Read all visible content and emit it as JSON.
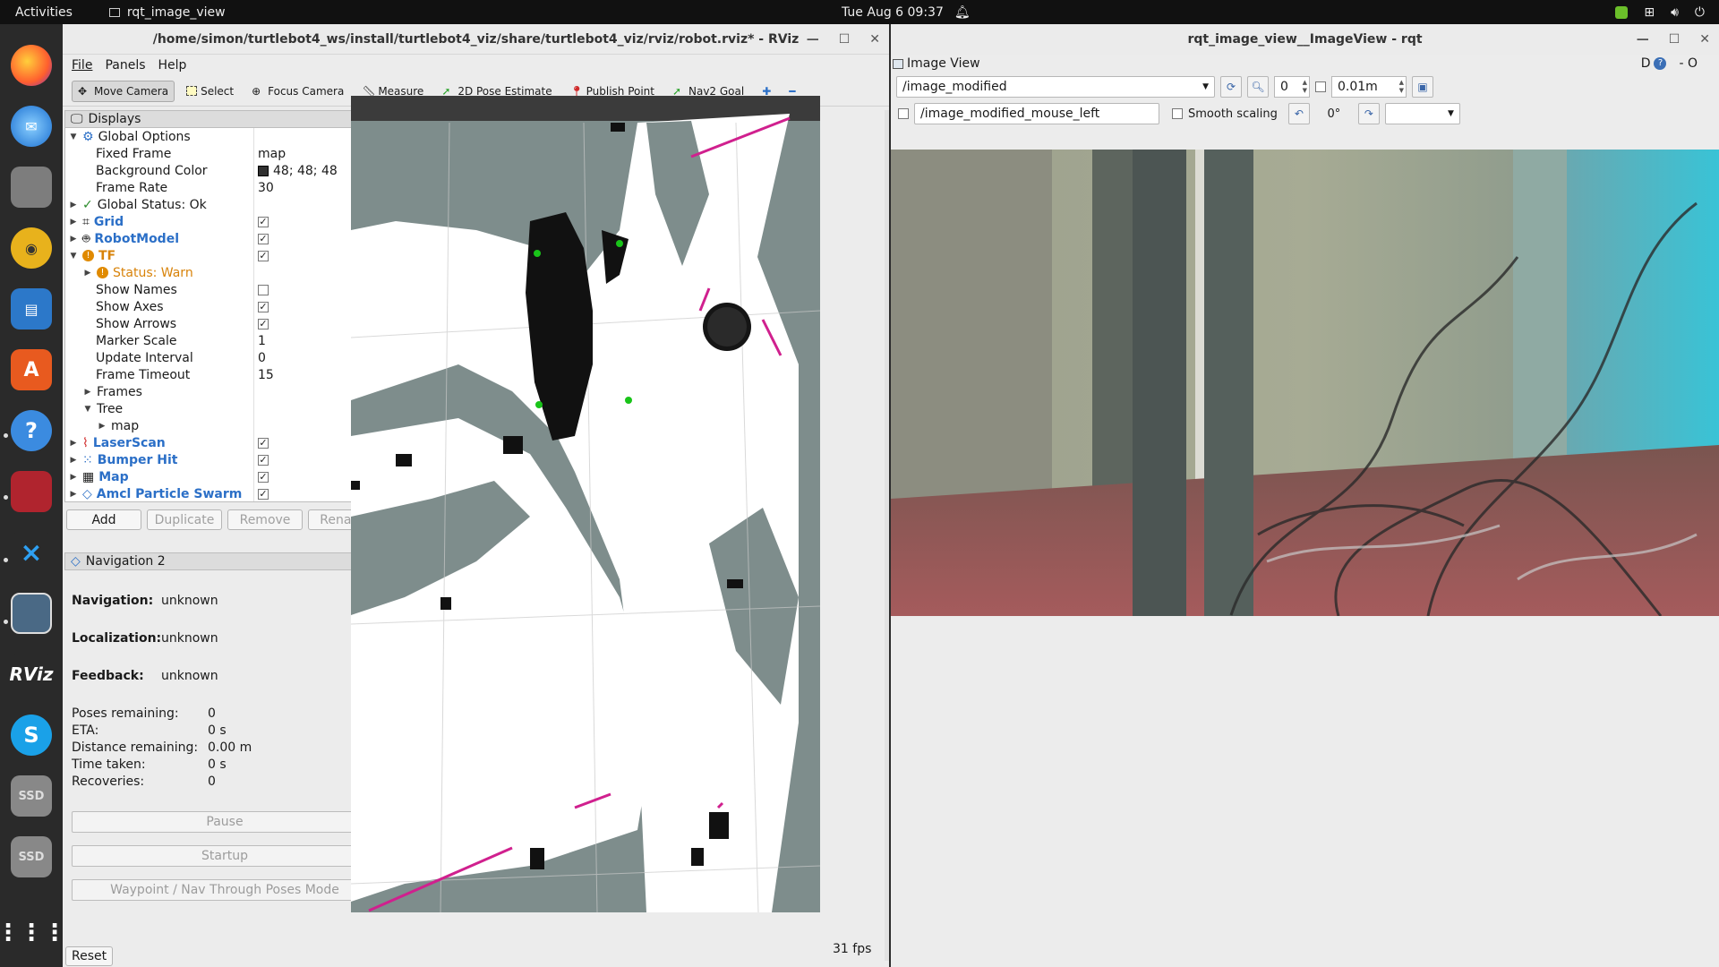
{
  "topbar": {
    "activities": "Activities",
    "app_name": "rqt_image_view",
    "clock": "Tue Aug 6  09:37"
  },
  "dock": {
    "items": [
      "Firefox",
      "Thunderbird",
      "Files",
      "Rhythmbox",
      "LibreOffice Writer",
      "Ubuntu Software",
      "Help",
      "Terminal",
      "Visual Studio Code",
      "Image Viewer",
      "RViz",
      "Skype",
      "SSD",
      "SSD",
      "Show Applications"
    ],
    "ssd_label": "SSD",
    "rviz_label": "RViz"
  },
  "rviz": {
    "title": "/home/simon/turtlebot4_ws/install/turtlebot4_viz/share/turtlebot4_viz/rviz/robot.rviz* - RViz",
    "menu": [
      "File",
      "Panels",
      "Help"
    ],
    "tools": [
      "Move Camera",
      "Select",
      "Focus Camera",
      "Measure",
      "2D Pose Estimate",
      "Publish Point",
      "Nav2 Goal"
    ],
    "displays": {
      "title": "Displays",
      "rows": [
        {
          "key": "Global Options",
          "value": ""
        },
        {
          "key": "Fixed Frame",
          "value": "map"
        },
        {
          "key": "Background Color",
          "value": "48; 48; 48"
        },
        {
          "key": "Frame Rate",
          "value": "30"
        },
        {
          "key": "Global Status: Ok",
          "value": ""
        },
        {
          "key": "Grid",
          "value": ""
        },
        {
          "key": "RobotModel",
          "value": ""
        },
        {
          "key": "TF",
          "value": ""
        },
        {
          "key": "Status: Warn",
          "value": ""
        },
        {
          "key": "Show Names",
          "value": ""
        },
        {
          "key": "Show Axes",
          "value": ""
        },
        {
          "key": "Show Arrows",
          "value": ""
        },
        {
          "key": "Marker Scale",
          "value": "1"
        },
        {
          "key": "Update Interval",
          "value": "0"
        },
        {
          "key": "Frame Timeout",
          "value": "15"
        },
        {
          "key": "Frames",
          "value": ""
        },
        {
          "key": "Tree",
          "value": ""
        },
        {
          "key": "map",
          "value": ""
        },
        {
          "key": "LaserScan",
          "value": ""
        },
        {
          "key": "Bumper Hit",
          "value": ""
        },
        {
          "key": "Map",
          "value": ""
        },
        {
          "key": "Amcl Particle Swarm",
          "value": ""
        }
      ],
      "buttons": [
        "Add",
        "Duplicate",
        "Remove",
        "Rename"
      ]
    },
    "nav2": {
      "title": "Navigation 2",
      "navigation_label": "Navigation:",
      "navigation_value": "unknown",
      "localization_label": "Localization:",
      "localization_value": "unknown",
      "feedback_label": "Feedback:",
      "feedback_value": "unknown",
      "poses_remaining_label": "Poses remaining:",
      "poses_remaining_value": "0",
      "eta_label": "ETA:",
      "eta_value": "0 s",
      "distance_label": "Distance remaining:",
      "distance_value": "0.00 m",
      "time_label": "Time taken:",
      "time_value": "0 s",
      "recoveries_label": "Recoveries:",
      "recoveries_value": "0",
      "pause_button": "Pause",
      "startup_button": "Startup",
      "waypoint_button": "Waypoint / Nav Through Poses Mode"
    },
    "reset_button": "Reset",
    "fps": "31 fps",
    "background_color": "#3d4a4a"
  },
  "rqt": {
    "title": "rqt_image_view__ImageView - rqt",
    "panel_title": "Image View",
    "panel_right": "D",
    "panel_right_extra": "- O",
    "topic": "/image_modified",
    "zoom_value": "0",
    "distance_value": "0.01m",
    "mouse_topic": "/image_modified_mouse_left",
    "smooth_scaling": "Smooth scaling",
    "rotation": "0°"
  }
}
